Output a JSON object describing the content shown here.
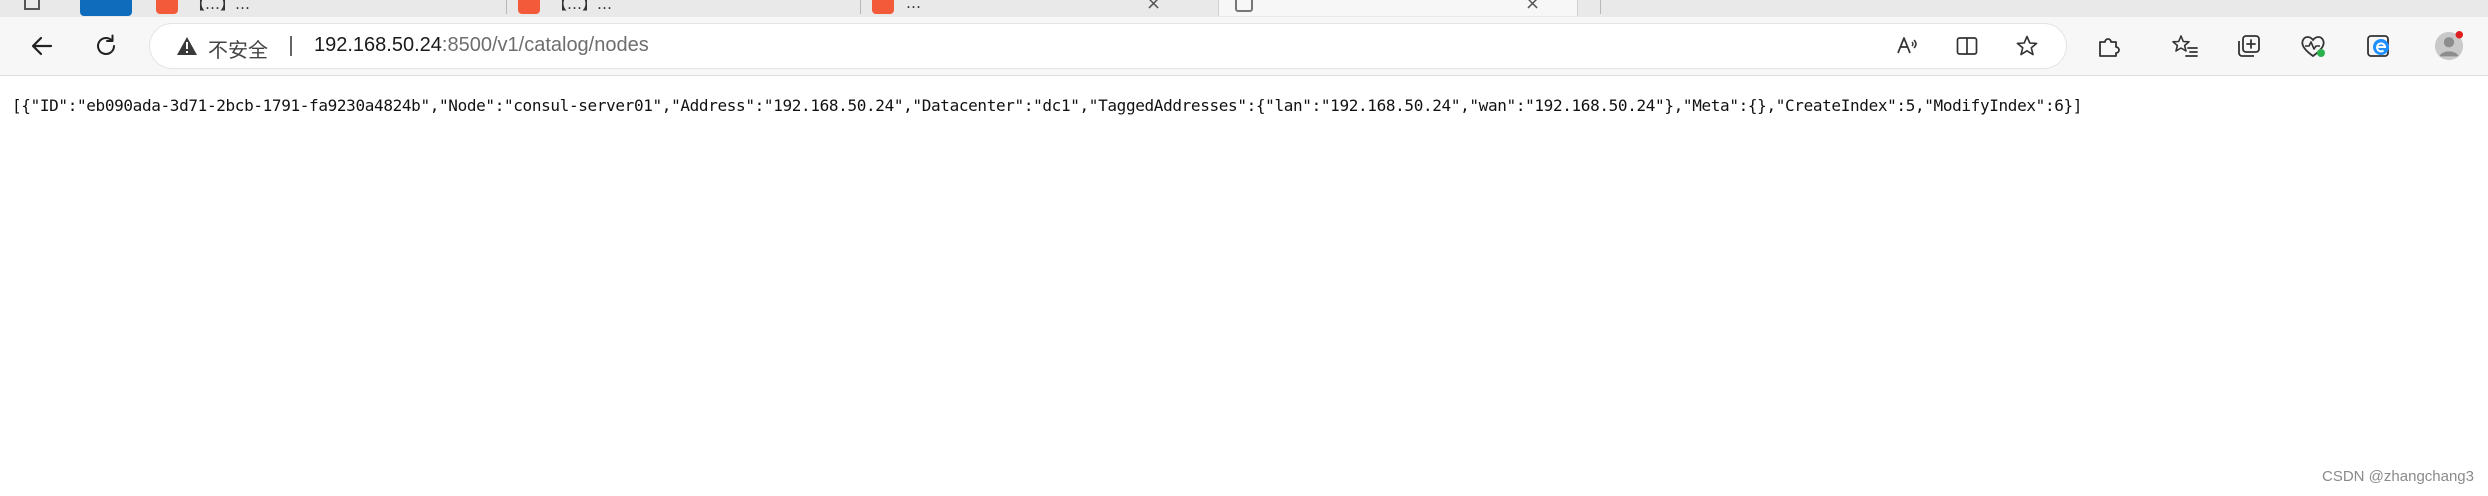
{
  "tabs": [
    {
      "title": "【…】…",
      "close": "×"
    },
    {
      "title": "【…】…",
      "close": "×"
    },
    {
      "title": "…",
      "close": "×"
    },
    {
      "title": "",
      "close": "×"
    }
  ],
  "address_bar": {
    "security_label": "不安全",
    "url_host": "192.168.50.24",
    "url_rest": ":8500/v1/catalog/nodes"
  },
  "icons": {
    "back": "back-arrow-icon",
    "refresh": "refresh-icon",
    "warning": "warning-icon",
    "read_aloud": "read-aloud-icon",
    "split_screen": "split-screen-icon",
    "favorite": "star-icon",
    "extensions": "puzzle-icon",
    "favorites_list": "favorites-icon",
    "collections": "collections-icon",
    "health": "heart-pulse-icon",
    "edge": "edge-icon",
    "profile": "avatar-icon"
  },
  "page": {
    "json_text": "[{\"ID\":\"eb090ada-3d71-2bcb-1791-fa9230a4824b\",\"Node\":\"consul-server01\",\"Address\":\"192.168.50.24\",\"Datacenter\":\"dc1\",\"TaggedAddresses\":{\"lan\":\"192.168.50.24\",\"wan\":\"192.168.50.24\"},\"Meta\":{},\"CreateIndex\":5,\"ModifyIndex\":6}]",
    "watermark": "CSDN @zhangchang3"
  },
  "colors": {
    "favicon": "#f25a3a",
    "edge_blue": "#1e90ff",
    "health_green": "#2bb24c",
    "notification_red": "#e02020"
  }
}
